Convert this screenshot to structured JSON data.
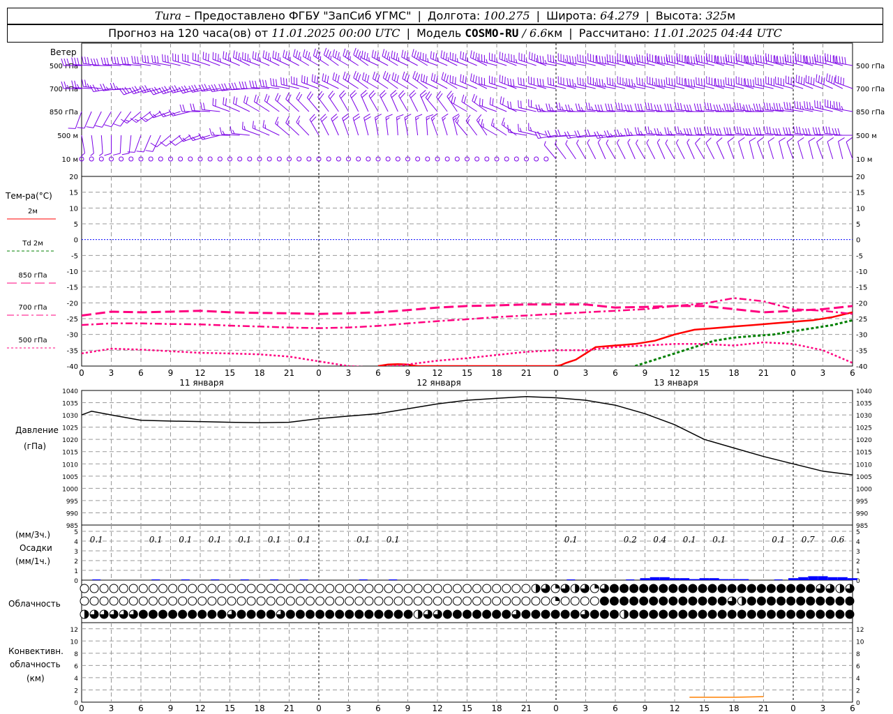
{
  "header": {
    "station": "Tura",
    "dash": "–",
    "provider": "Предоставлено ФГБУ \"ЗапСиб УГМС\"",
    "lon_label": "Долгота:",
    "lon": "100.275",
    "lat_label": "Широта:",
    "lat": "64.279",
    "alt_label": "Высота:",
    "alt": "325",
    "alt_unit": "м",
    "forecast_label": "Прогноз на 120 часа(ов) от",
    "forecast_start": "11.01.2025 00:00 UTC",
    "model_label": "Модель",
    "model": "COSMO-RU",
    "model_res": "/ 6.6",
    "model_res_unit": "км",
    "computed_label": "Рассчитано:",
    "computed": "11.01.2025 04:44 UTC"
  },
  "labels": {
    "wind_title": "Ветер",
    "wind_levels": [
      "500 гПа",
      "700 гПа",
      "850 гПа",
      "500 м",
      "10  м"
    ],
    "temp_title": "Тем-ра(°C)",
    "temp_legend": [
      {
        "label": "2м",
        "color": "#ff0000",
        "dash": ""
      },
      {
        "label": "Td  2м",
        "color": "#008000",
        "dash": "4,3"
      },
      {
        "label": "850 гПа",
        "color": "#ff007f",
        "dash": "14,6"
      },
      {
        "label": "700 гПа",
        "color": "#ff007f",
        "dash": "10,4,3,4"
      },
      {
        "label": "500 гПа",
        "color": "#ff007f",
        "dash": "3,3"
      }
    ],
    "pressure_title": "Давление",
    "pressure_unit": "(гПа)",
    "precip_unit_top": "(мм/3ч.)",
    "precip_title": "Осадки",
    "precip_unit_bottom": "(мм/1ч.)",
    "cloud_title": "Облачность",
    "conv_title_1": "Конвективн.",
    "conv_title_2": "облачность",
    "conv_unit": "(км)",
    "days": [
      "11 января",
      "12 января",
      "13 января"
    ]
  },
  "colors": {
    "wind": "#7a00e6",
    "t2m": "#ff0000",
    "td2m": "#008000",
    "upper": "#ff007f",
    "zero_line": "#0000ff",
    "pressure": "#000000",
    "precip": "#0000ff",
    "conv": "#ff8000",
    "grid": "#999999"
  },
  "chart_data": [
    {
      "type": "line",
      "panel": "temperature",
      "x_ticks": [
        "0",
        "3",
        "6",
        "9",
        "12",
        "15",
        "18",
        "21",
        "0",
        "3",
        "6",
        "9",
        "12",
        "15",
        "18",
        "21",
        "0",
        "3",
        "6",
        "9",
        "12",
        "15",
        "18",
        "21",
        "0",
        "3",
        "6"
      ],
      "x_hours": [
        0,
        3,
        6,
        9,
        12,
        15,
        18,
        21,
        24,
        27,
        30,
        33,
        36,
        39,
        42,
        45,
        48,
        51,
        54,
        57,
        60,
        63,
        66,
        69,
        72,
        75,
        78
      ],
      "ylim": [
        -40,
        20
      ],
      "y_ticks": [
        20,
        15,
        10,
        5,
        0,
        -5,
        -10,
        -15,
        -20,
        -25,
        -30,
        -35,
        -40
      ],
      "series": [
        {
          "name": "2м",
          "x": [
            30,
            31,
            32,
            33,
            33.5,
            34,
            48,
            48.5,
            49,
            50,
            51,
            52,
            54,
            56,
            58,
            60,
            62,
            64,
            66,
            68,
            70,
            72,
            74,
            76,
            78
          ],
          "y": [
            -40,
            -39.5,
            -39.4,
            -39.5,
            -39.8,
            -40,
            -40,
            -39.7,
            -39,
            -38,
            -36,
            -34,
            -33.5,
            -33,
            -32,
            -30,
            -28.5,
            -28,
            -27.5,
            -27,
            -26.5,
            -26,
            -25.5,
            -24.5,
            -23
          ]
        },
        {
          "name": "Td  2м",
          "x": [
            56,
            58,
            60,
            62,
            64,
            66,
            68,
            70,
            72,
            74,
            76,
            78
          ],
          "y": [
            -40,
            -38,
            -36,
            -34,
            -32,
            -31,
            -30.5,
            -30,
            -29,
            -28,
            -27,
            -25.5
          ]
        },
        {
          "name": "850 гПа",
          "x": [
            0,
            3,
            6,
            9,
            12,
            15,
            18,
            21,
            24,
            27,
            30,
            33,
            36,
            39,
            42,
            45,
            48,
            51,
            54,
            57,
            60,
            63,
            66,
            69,
            72,
            75,
            78
          ],
          "y": [
            -24,
            -22.8,
            -23,
            -22.8,
            -22.5,
            -23,
            -23.2,
            -23.3,
            -23.5,
            -23.3,
            -23,
            -22.3,
            -21.5,
            -21,
            -20.8,
            -20.5,
            -20.5,
            -20.5,
            -21.5,
            -21.3,
            -21,
            -21,
            -22,
            -23,
            -22.5,
            -22,
            -21
          ]
        },
        {
          "name": "700 гПа",
          "x": [
            0,
            3,
            6,
            9,
            12,
            15,
            18,
            21,
            24,
            27,
            30,
            33,
            36,
            39,
            42,
            45,
            48,
            51,
            54,
            57,
            60,
            63,
            66,
            69,
            72,
            75,
            78
          ],
          "y": [
            -27,
            -26.5,
            -26.5,
            -26.7,
            -26.8,
            -27.2,
            -27.5,
            -27.8,
            -28,
            -27.8,
            -27.3,
            -26.5,
            -25.8,
            -25.2,
            -24.5,
            -24,
            -23.5,
            -23,
            -22.5,
            -22,
            -21,
            -20.2,
            -18.5,
            -19.5,
            -22,
            -22.5,
            -23.5
          ]
        },
        {
          "name": "500 гПа",
          "x": [
            0,
            3,
            6,
            9,
            12,
            15,
            18,
            21,
            24,
            27,
            30,
            33,
            36,
            39,
            42,
            45,
            48,
            51,
            54,
            57,
            60,
            63,
            66,
            69,
            72,
            75,
            78
          ],
          "y": [
            -36,
            -34.5,
            -34.8,
            -35.3,
            -35.8,
            -36,
            -36.3,
            -37,
            -38.5,
            -40,
            -40.5,
            -39.5,
            -38.3,
            -37.5,
            -36.5,
            -35.5,
            -35,
            -35,
            -34,
            -33.5,
            -33,
            -33,
            -33.5,
            -32.5,
            -33,
            -35,
            -39
          ]
        }
      ]
    },
    {
      "type": "line",
      "panel": "pressure",
      "ylim": [
        985,
        1040
      ],
      "y_ticks": [
        1040,
        1035,
        1030,
        1025,
        1020,
        1015,
        1010,
        1005,
        1000,
        995,
        990,
        985
      ],
      "series": [
        {
          "name": "Давление",
          "x": [
            0,
            1,
            3,
            6,
            9,
            12,
            15,
            18,
            21,
            24,
            27,
            30,
            33,
            36,
            39,
            42,
            45,
            48,
            51,
            54,
            57,
            60,
            63,
            66,
            69,
            72,
            75,
            78
          ],
          "y": [
            1030,
            1031.5,
            1030,
            1027.8,
            1027.5,
            1027.3,
            1027,
            1026.8,
            1027,
            1028.5,
            1029.5,
            1030.5,
            1032.5,
            1034.5,
            1036,
            1036.8,
            1037.5,
            1037,
            1036,
            1034,
            1030.5,
            1026,
            1020,
            1016.5,
            1013,
            1010,
            1007,
            1005.5
          ]
        }
      ]
    },
    {
      "type": "bar",
      "panel": "precipitation",
      "ylim": [
        0,
        5
      ],
      "y_ticks": [
        5,
        4,
        3,
        2,
        1,
        0
      ],
      "labels_x": [
        1.5,
        7.5,
        10.5,
        13.5,
        16.5,
        19.5,
        22.5,
        28.5,
        31.5,
        49.5,
        55.5,
        58.5,
        61.5,
        64.5,
        70.5,
        73.5,
        76.5
      ],
      "labels": [
        "0.1",
        "0.1",
        "0.1",
        "0.1",
        "0.1",
        "0.1",
        "0.1",
        "0.1",
        "0.1",
        "0.1",
        "0.2",
        "0.4",
        "0.1",
        "0.1",
        "0.1",
        "0.7",
        "0.6"
      ],
      "hourly_x": [
        57,
        58,
        59,
        60,
        61,
        62,
        63,
        64,
        65,
        66,
        67,
        72,
        73,
        74,
        75,
        76,
        77,
        78
      ],
      "hourly": [
        0.2,
        0.3,
        0.3,
        0.2,
        0.2,
        0.1,
        0.2,
        0.2,
        0.1,
        0.1,
        0.1,
        0.2,
        0.3,
        0.4,
        0.4,
        0.3,
        0.3,
        0.2
      ]
    },
    {
      "type": "table",
      "panel": "cloudiness",
      "rows": [
        {
          "name": "upper",
          "cover": [
            0,
            0,
            0,
            0,
            0,
            0,
            0,
            0,
            0,
            0,
            0,
            0,
            0,
            0,
            0,
            0,
            0,
            0,
            0,
            0,
            0,
            0,
            0,
            0,
            0,
            0,
            0,
            0,
            0,
            0,
            0,
            0,
            0,
            0,
            0,
            0,
            0,
            0,
            0,
            0,
            0,
            0,
            0,
            0,
            0,
            0,
            0.5,
            0.75,
            0.25,
            0.75,
            0.5,
            0.75,
            0.25,
            0.75,
            1,
            1,
            1,
            1,
            1,
            1,
            1,
            1,
            1,
            1,
            1,
            1,
            1,
            1,
            1,
            1,
            1,
            1,
            1,
            1,
            1,
            0.75,
            0.75,
            0.5,
            0.75
          ]
        },
        {
          "name": "middle",
          "cover": [
            0,
            0,
            0,
            0,
            0,
            0,
            0,
            0,
            0,
            0,
            0,
            0,
            0,
            0,
            0,
            0,
            0,
            0,
            0,
            0,
            0,
            0,
            0,
            0,
            0,
            0,
            0,
            0,
            0,
            0,
            0,
            0,
            0,
            0,
            0,
            0,
            0,
            0,
            0,
            0,
            0,
            0,
            0,
            0,
            0,
            0,
            0,
            0,
            0.25,
            0,
            0,
            0,
            0,
            1,
            1,
            1,
            1,
            1,
            1,
            1,
            1,
            1,
            1,
            1,
            1,
            1,
            0.75,
            0.5,
            1,
            1,
            1,
            1,
            1,
            1,
            1,
            1,
            1,
            1,
            1
          ]
        },
        {
          "name": "lower",
          "cover": [
            0.5,
            0.75,
            0.75,
            0.75,
            0.75,
            0.75,
            1,
            1,
            1,
            1,
            1,
            1,
            1,
            1,
            1,
            0.75,
            1,
            1,
            1,
            1,
            0.75,
            1,
            1,
            1,
            1,
            1,
            1,
            1,
            1,
            1,
            1,
            1,
            1,
            1,
            0.5,
            0.75,
            0.75,
            1,
            1,
            1,
            1,
            1,
            1,
            1,
            0.75,
            1,
            1,
            1,
            1,
            1,
            1,
            0.75,
            1,
            1,
            1,
            0.5,
            1,
            1,
            1,
            1,
            1,
            1,
            1,
            1,
            1,
            1,
            1,
            1,
            1,
            1,
            1,
            1,
            1,
            1,
            1,
            1,
            1,
            1,
            1
          ]
        }
      ]
    },
    {
      "type": "line",
      "panel": "convective",
      "ylim": [
        0,
        13
      ],
      "y_ticks": [
        12,
        10,
        8,
        6,
        4,
        2,
        0
      ],
      "series": [
        {
          "name": "Конвективн. облачность",
          "x": [
            61.5,
            66,
            69
          ],
          "y": [
            0.8,
            0.8,
            0.9
          ]
        }
      ]
    },
    {
      "type": "table",
      "panel": "wind",
      "levels": [
        "500 гПа",
        "700 гПа",
        "850 гПа",
        "500 м",
        "10  м"
      ],
      "dir_deg": [
        [
          270,
          270,
          275,
          280,
          285,
          290,
          290,
          295,
          300,
          300,
          295,
          295,
          290,
          290,
          285,
          285,
          280,
          280,
          280,
          280,
          280,
          280,
          280,
          280,
          280,
          280,
          280
        ],
        [
          270,
          260,
          250,
          250,
          255,
          260,
          270,
          280,
          290,
          300,
          300,
          300,
          295,
          290,
          285,
          280,
          280,
          280,
          280,
          280,
          280,
          280,
          280,
          280,
          285,
          290,
          290
        ],
        [
          200,
          210,
          230,
          250,
          270,
          290,
          300,
          310,
          320,
          330,
          330,
          330,
          320,
          300,
          290,
          280,
          270,
          270,
          270,
          270,
          270,
          270,
          270,
          270,
          275,
          280,
          280
        ],
        [
          170,
          180,
          200,
          230,
          250,
          270,
          290,
          310,
          330,
          340,
          350,
          350,
          340,
          320,
          300,
          280,
          260,
          260,
          260,
          270,
          270,
          270,
          270,
          270,
          270,
          270,
          270
        ],
        [
          0,
          0,
          0,
          0,
          0,
          0,
          0,
          0,
          0,
          0,
          0,
          0,
          0,
          0,
          0,
          0,
          320,
          330,
          330,
          330,
          330,
          330,
          340,
          340,
          340,
          340,
          340
        ]
      ],
      "speed_ms": [
        [
          15,
          15,
          16,
          16,
          16,
          17,
          17,
          17,
          18,
          18,
          18,
          18,
          18,
          18,
          18,
          18,
          18,
          20,
          22,
          24,
          25,
          25,
          25,
          25,
          25,
          25,
          25
        ],
        [
          12,
          13,
          14,
          15,
          15,
          15,
          15,
          15,
          15,
          15,
          15,
          15,
          15,
          15,
          15,
          15,
          16,
          17,
          18,
          18,
          19,
          20,
          20,
          20,
          20,
          20,
          20
        ],
        [
          5,
          6,
          7,
          8,
          9,
          10,
          10,
          10,
          11,
          11,
          10,
          10,
          9,
          9,
          9,
          9,
          12,
          13,
          14,
          15,
          16,
          16,
          17,
          17,
          17,
          17,
          17
        ],
        [
          3,
          4,
          5,
          6,
          7,
          8,
          8,
          8,
          9,
          9,
          8,
          8,
          7,
          7,
          7,
          7,
          10,
          11,
          12,
          13,
          13,
          14,
          14,
          14,
          14,
          14,
          14
        ],
        [
          0,
          0,
          0,
          0,
          0,
          0,
          0,
          0,
          0,
          0,
          0,
          0,
          0,
          0,
          0,
          0,
          3,
          3,
          3,
          3,
          3,
          4,
          4,
          4,
          4,
          4,
          4
        ]
      ]
    }
  ]
}
